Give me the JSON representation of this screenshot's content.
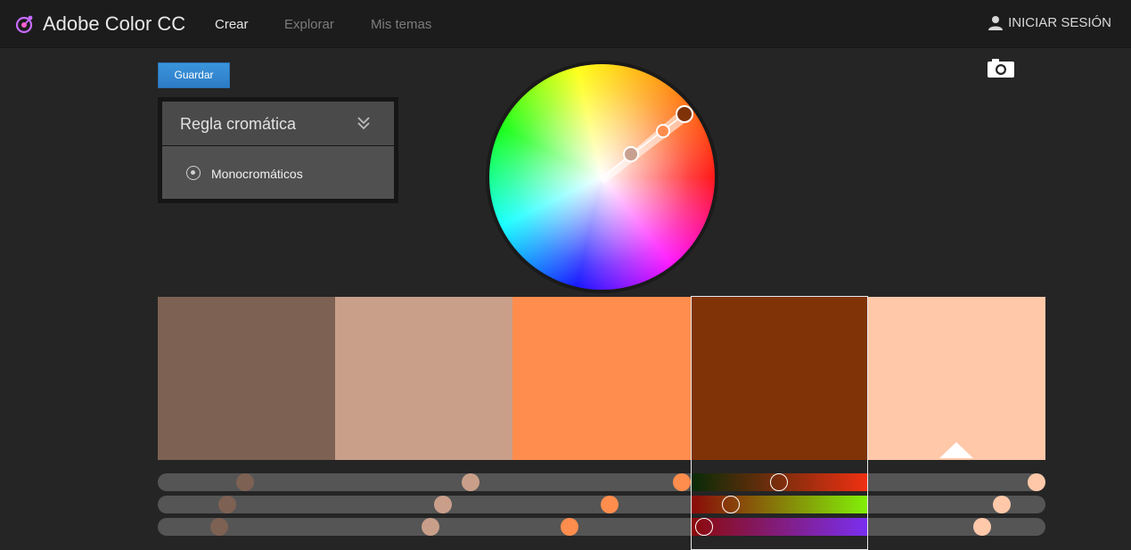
{
  "header": {
    "brand": "Adobe Color CC",
    "nav": [
      {
        "label": "Crear",
        "active": true
      },
      {
        "label": "Explorar",
        "active": false
      },
      {
        "label": "Mis temas",
        "active": false
      }
    ],
    "signin": "INICIAR SESIÓN"
  },
  "toolbar": {
    "save_label": "Guardar"
  },
  "rule_panel": {
    "title": "Regla cromática",
    "option": "Monocromáticos"
  },
  "wheel": {
    "markers": [
      "#c8a08f",
      "#ff8c4d",
      "#7f3208"
    ]
  },
  "swatches": [
    {
      "color": "#7d6153"
    },
    {
      "color": "#c99f8a"
    },
    {
      "color": "#ff8d4d"
    },
    {
      "color": "#7f3307",
      "selected": true
    },
    {
      "color": "#ffc8a9"
    }
  ],
  "sliders": {
    "selected_swatch_index": 3,
    "rows": [
      {
        "name": "red",
        "fill": [
          "#072b07",
          "#f03012"
        ],
        "values": [
          0.49,
          0.79,
          1.0,
          0.5,
          1.0
        ]
      },
      {
        "name": "green",
        "fill": [
          "#8a0a0a",
          "#82f008"
        ],
        "values": [
          0.38,
          0.62,
          0.55,
          0.2,
          0.78
        ]
      },
      {
        "name": "blue",
        "fill": [
          "#8a0a0a",
          "#7a2ff0"
        ],
        "values": [
          0.33,
          0.54,
          0.3,
          0.03,
          0.66
        ]
      }
    ]
  },
  "icons": {
    "brand": "adobe-color-logo-icon",
    "signin": "user-icon",
    "rule_toggle": "double-chevron-down-icon",
    "radio": "radio-selected-icon",
    "camera": "camera-icon"
  }
}
